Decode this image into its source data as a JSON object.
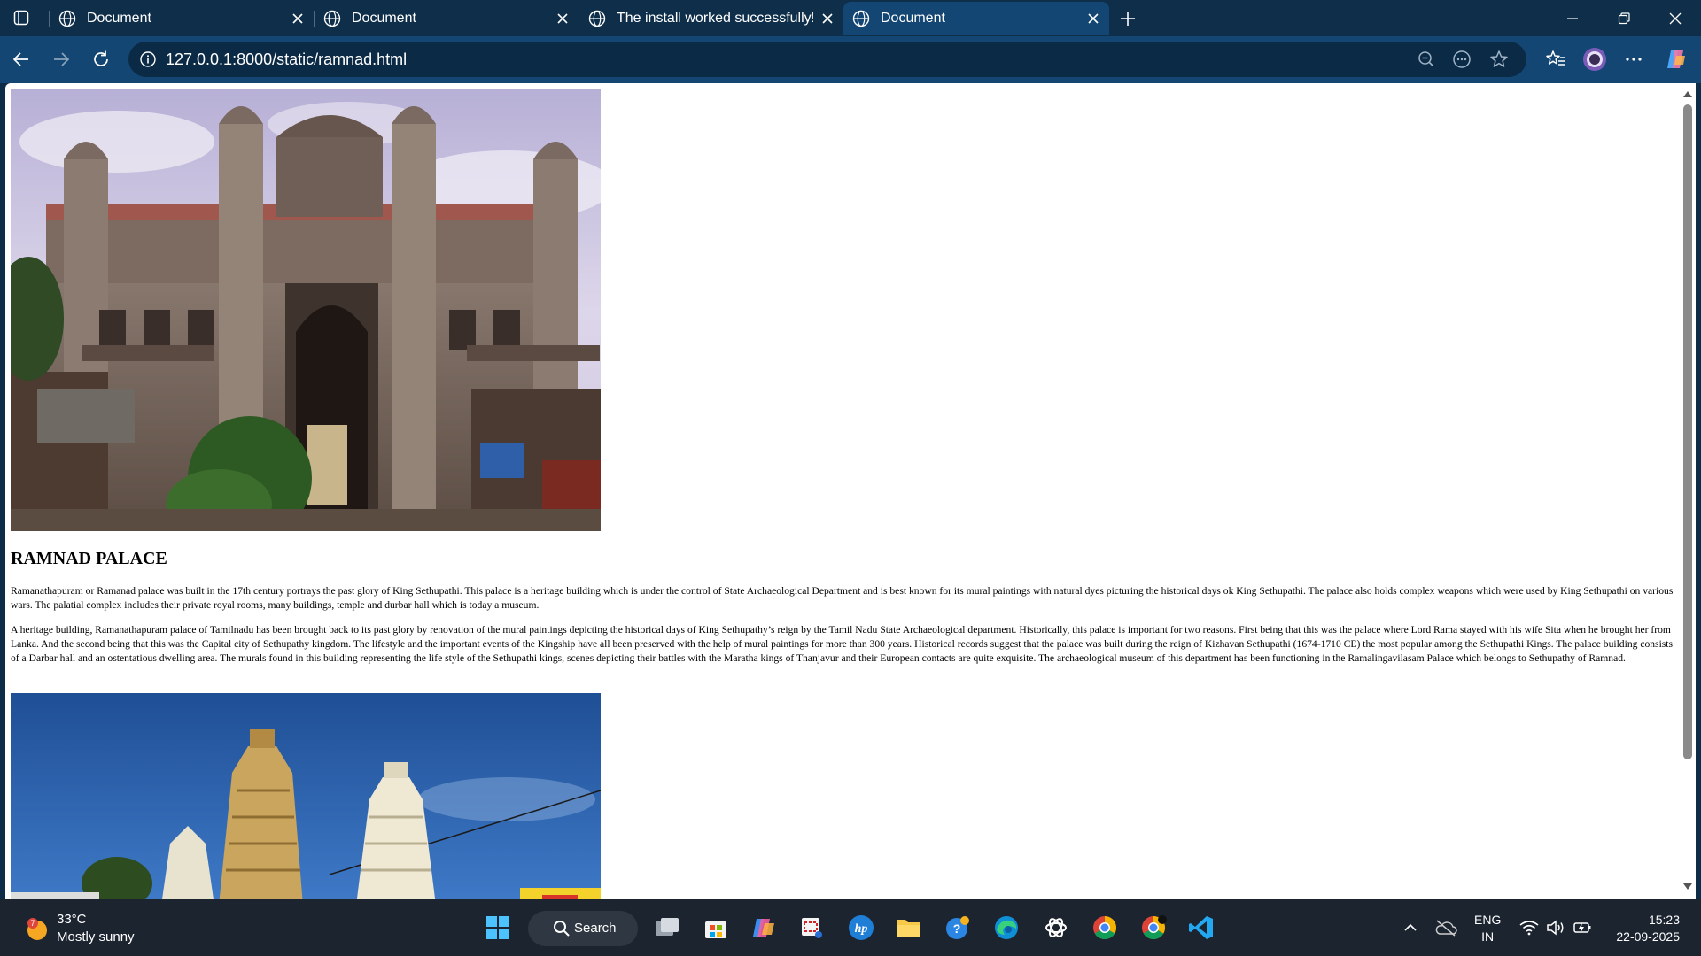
{
  "browser": {
    "tabs": [
      {
        "title": "Document",
        "active": false
      },
      {
        "title": "Document",
        "active": false
      },
      {
        "title": "The install worked successfully! Co",
        "active": false
      },
      {
        "title": "Document",
        "active": true
      }
    ],
    "url": "127.0.0.1:8000/static/ramnad.html"
  },
  "page": {
    "heading": "RAMNAD PALACE",
    "paragraphs": [
      "Ramanathapuram or Ramanad palace was built in the 17th century portrays the past glory of King Sethupathi. This palace is a heritage building which is under the control of State Archaeological Department and is best known for its mural paintings with natural dyes picturing the historical days ok King Sethupathi. The palace also holds complex weapons which were used by King Sethupathi on various wars. The palatial complex includes their private royal rooms, many buildings, temple and durbar hall which is today a museum.",
      "A heritage building, Ramanathapuram palace of Tamilnadu has been brought back to its past glory by renovation of the mural paintings depicting the historical days of King Sethupathy’s reign by the Tamil Nadu State Archaeological department. Historically, this palace is important for two reasons. First being that this was the palace where Lord Rama stayed with his wife Sita when he brought her from Lanka. And the second being that this was the Capital city of Sethupathy kingdom. The lifestyle and the important events of the Kingship have all been preserved with the help of mural paintings for more than 300 years. Historical records suggest that the palace was built during the reign of Kizhavan Sethupathi (1674-1710 CE) the most popular among the Sethupathi Kings. The palace building consists of a Darbar hall and an ostentatious dwelling area. The murals found in this building representing the life style of the Sethupathi kings, scenes depicting their battles with the Maratha kings of Thanjavur and their European contacts are quite exquisite. The archaeological museum of this department has been functioning in the Ramalingavilasam Palace which belongs to Sethupathy of Ramnad."
    ]
  },
  "taskbar": {
    "weather": {
      "badge": "7",
      "temp": "33°C",
      "condition": "Mostly sunny"
    },
    "search_label": "Search",
    "lang": {
      "line1": "ENG",
      "line2": "IN"
    },
    "clock": {
      "time": "15:23",
      "date": "22-09-2025"
    },
    "apps": [
      "task-view",
      "microsoft-store",
      "copilot",
      "snipping-tool",
      "hp",
      "file-explorer",
      "get-help",
      "edge",
      "chatgpt",
      "chrome",
      "chrome-profile",
      "vscode"
    ]
  },
  "colors": {
    "titlebar": "#0e2e4a",
    "toolbar": "#134673",
    "taskbar": "#1c2430"
  }
}
